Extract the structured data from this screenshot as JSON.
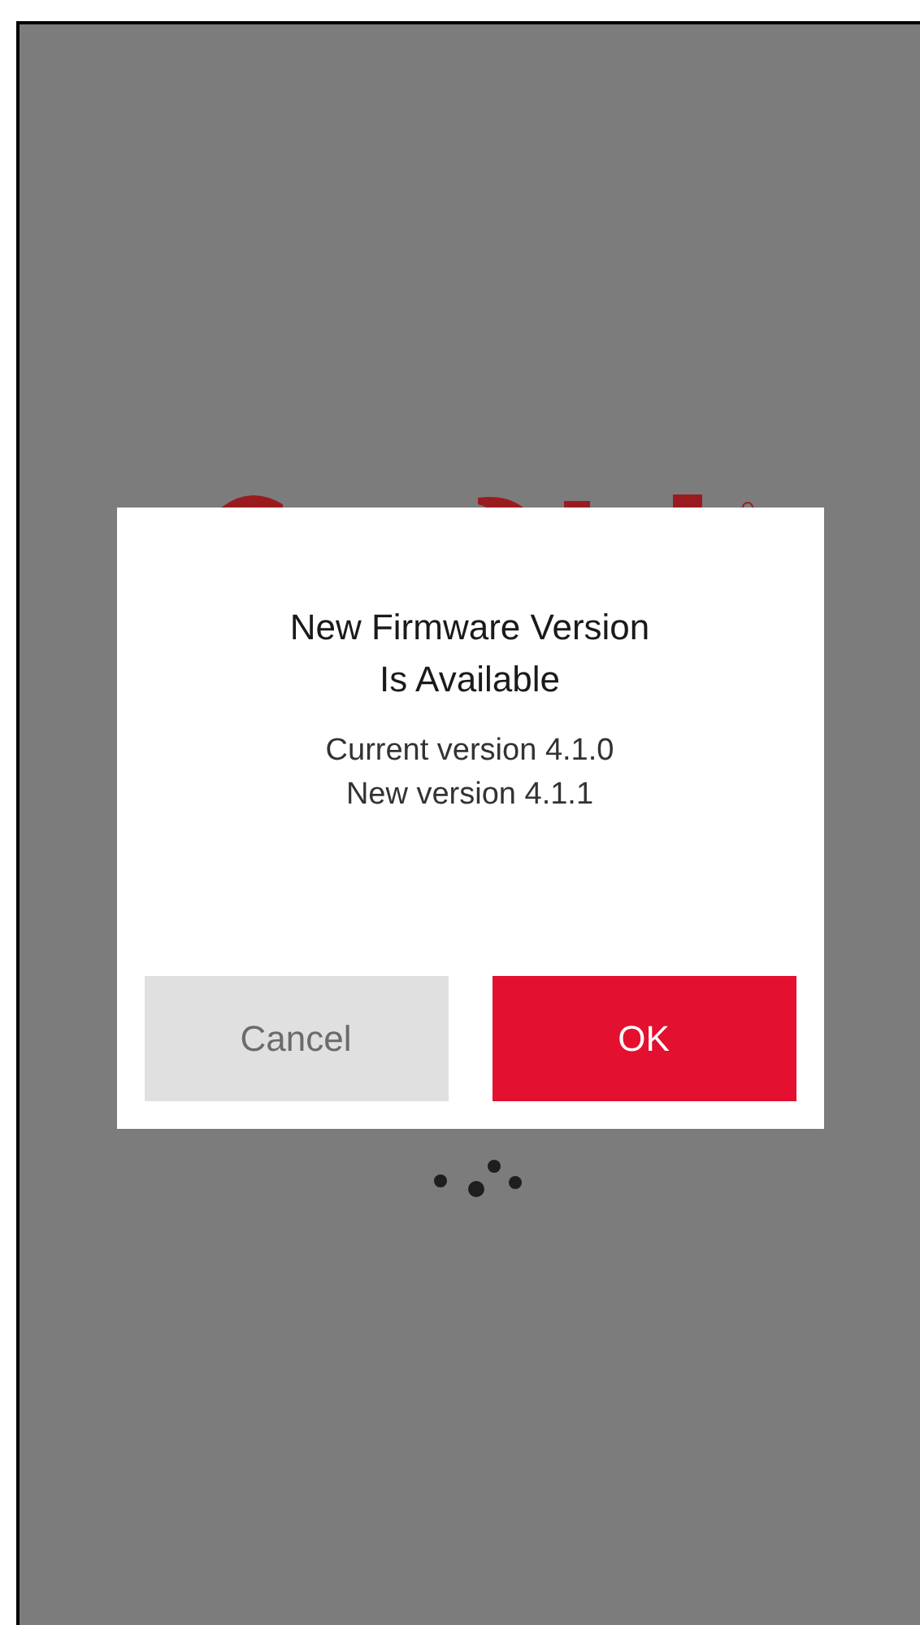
{
  "dialog": {
    "title": "New Firmware Version\nIs Available",
    "message": "Current version 4.1.0\nNew version 4.1.1",
    "buttons": [
      {
        "label": "Cancel",
        "kind": "secondary"
      },
      {
        "label": "OK",
        "kind": "primary"
      }
    ]
  }
}
